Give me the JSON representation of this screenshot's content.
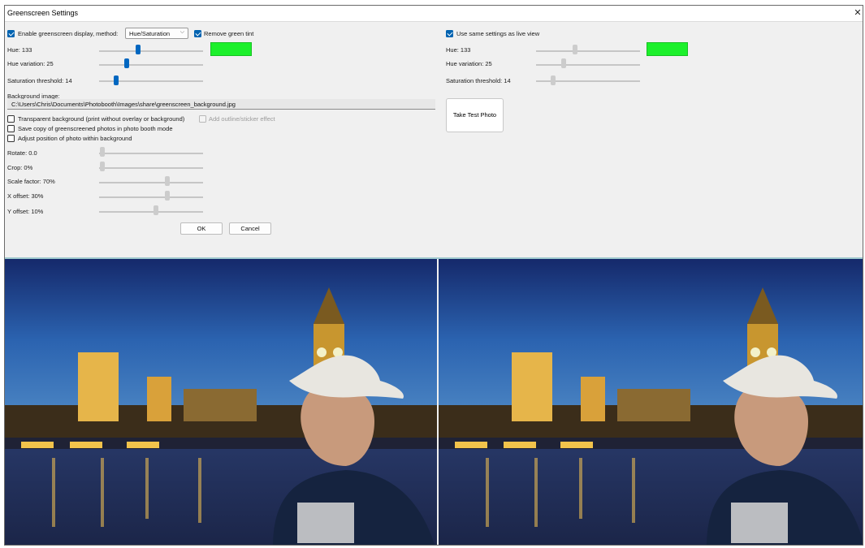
{
  "window": {
    "title": "Greenscreen Settings",
    "close_glyph": "✕"
  },
  "left": {
    "enable_label": "Enable greenscreen display, method:",
    "enable_checked": true,
    "method": {
      "selected": "Hue/Saturation"
    },
    "remove_tint_label": "Remove green tint",
    "remove_tint_checked": true,
    "hue": {
      "label": "Hue: 133",
      "value": 133,
      "min": 0,
      "max": 360
    },
    "hue_variation": {
      "label": "Hue variation: 25",
      "value": 25
    },
    "saturation_threshold": {
      "label": "Saturation threshold: 14",
      "value": 14
    },
    "background_image_label": "Background image:",
    "background_image_path": "C:\\Users\\Chris\\Documents\\Photobooth\\Images\\share\\greenscreen_background.jpg",
    "transparent_bg_label": "Transparent background (print without overlay or background)",
    "transparent_bg_checked": false,
    "outline_label": "Add outline/sticker effect",
    "outline_enabled": false,
    "save_copy_label": "Save copy of greenscreened photos in photo booth mode",
    "save_copy_checked": false,
    "adjust_position_label": "Adjust position of photo within background",
    "adjust_position_checked": false,
    "rotate": {
      "label": "Rotate: 0.0",
      "value": 0.0
    },
    "crop": {
      "label": "Crop: 0%",
      "value": 0
    },
    "scale": {
      "label": "Scale factor: 70%",
      "value": 70
    },
    "x_offset": {
      "label": "X offset: 30%",
      "value": 30
    },
    "y_offset": {
      "label": "Y offset: 10%",
      "value": 10
    },
    "ok_label": "OK",
    "cancel_label": "Cancel"
  },
  "right": {
    "same_settings_label": "Use same settings as live view",
    "same_settings_checked": true,
    "hue": {
      "label": "Hue: 133",
      "value": 133
    },
    "hue_variation": {
      "label": "Hue variation: 25",
      "value": 25
    },
    "saturation_threshold": {
      "label": "Saturation threshold: 14",
      "value": 14
    },
    "test_photo_label": "Take Test Photo"
  },
  "colors": {
    "accent": "#0067c0",
    "hue_swatch": "#1cf02b",
    "divider": "#9ec9ce"
  },
  "previews": [
    {
      "name": "live-view-preview",
      "description_icon": "photo-preview"
    },
    {
      "name": "test-photo-preview",
      "description_icon": "photo-preview"
    }
  ]
}
